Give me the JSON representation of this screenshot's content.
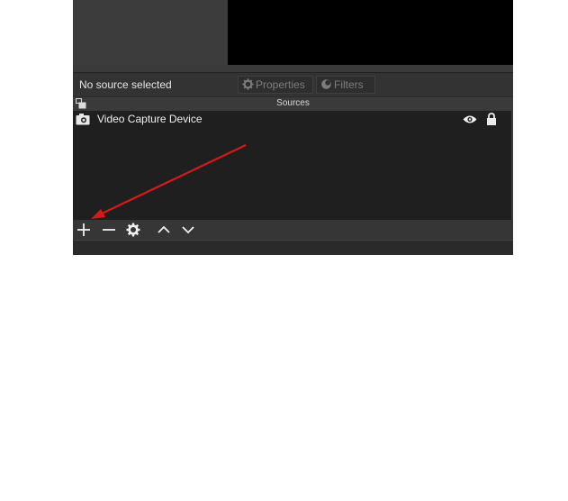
{
  "context_bar": {
    "selection_label": "No source selected",
    "properties_label": "Properties",
    "filters_label": "Filters"
  },
  "sources": {
    "title": "Sources",
    "items": [
      {
        "name": "Video Capture Device",
        "icon": "camera-icon",
        "visible": true,
        "locked": true
      }
    ],
    "toolbar_icons": [
      "add-icon",
      "remove-icon",
      "gear-icon",
      "move-up-icon",
      "move-down-icon"
    ]
  },
  "annotation": {
    "type": "arrow",
    "color": "#d61a1a",
    "points_to": "add-source-button"
  }
}
